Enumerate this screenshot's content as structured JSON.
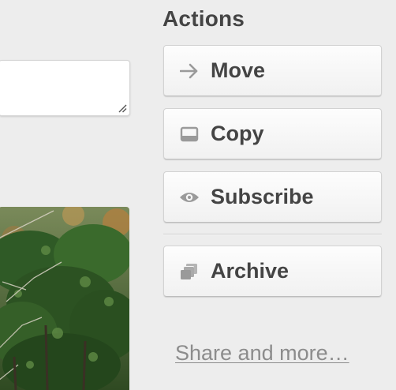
{
  "actions": {
    "title": "Actions",
    "move_label": "Move",
    "copy_label": "Copy",
    "subscribe_label": "Subscribe",
    "archive_label": "Archive",
    "share_label": "Share and more…"
  },
  "icons": {
    "move": "arrow-right-icon",
    "copy": "card-copy-icon",
    "subscribe": "eye-icon",
    "archive": "archive-icon"
  },
  "colors": {
    "background": "#ededed",
    "button_text": "#444444",
    "icon": "#9a9a9a",
    "link": "#8c8c8c"
  }
}
